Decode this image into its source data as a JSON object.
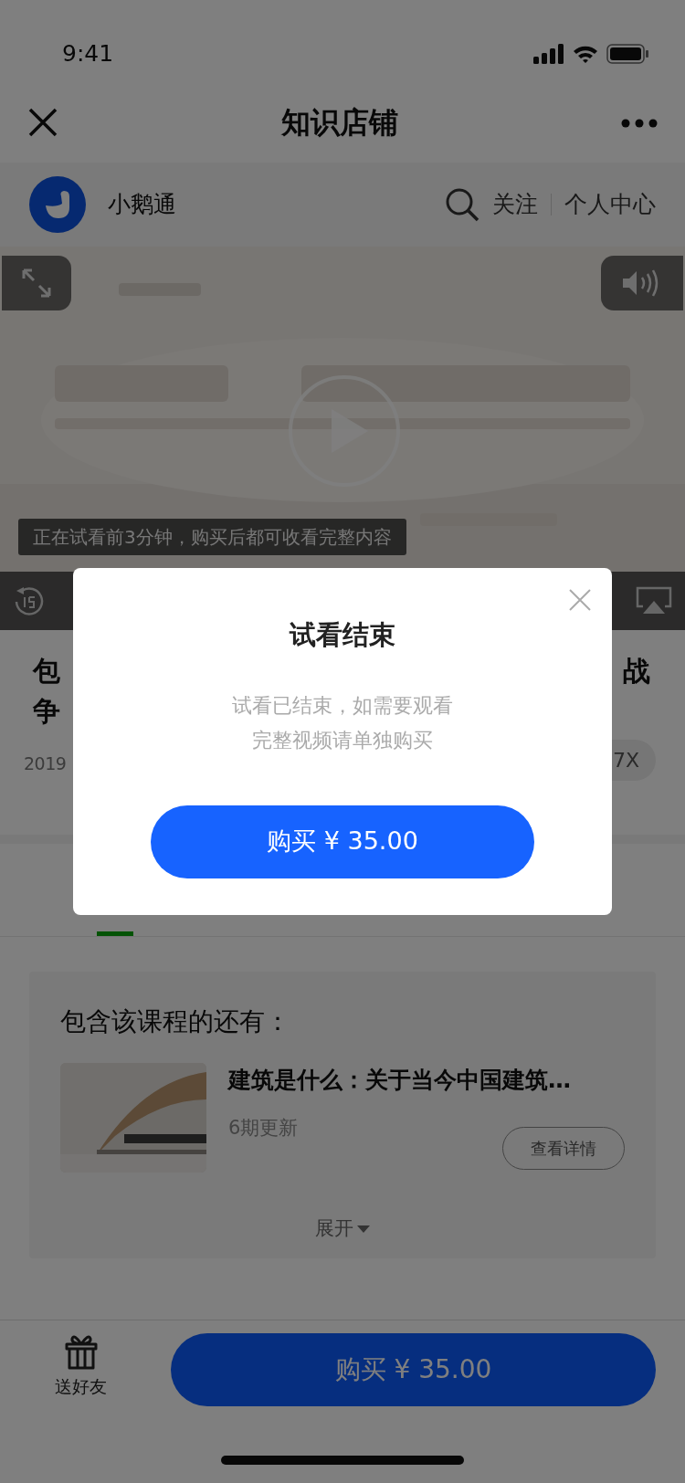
{
  "status_bar": {
    "time": "9:41"
  },
  "nav": {
    "title": "知识店铺"
  },
  "shop": {
    "name": "小鹅通",
    "follow": "关注",
    "personal_center": "个人中心"
  },
  "video": {
    "trial_notice": "正在试看前3分钟，购买后都可收看完整内容"
  },
  "course": {
    "title_line1_start": "包",
    "title_line2_start": "争",
    "title_line1_end": "战",
    "date_start": "2019",
    "speed": "7X"
  },
  "tabs": [
    {
      "selected": true
    }
  ],
  "bundle": {
    "heading": "包含该课程的还有：",
    "items": [
      {
        "title": "建筑是什么：关于当今中国建筑…",
        "updates": "6期更新",
        "action": "查看详情"
      }
    ],
    "expand": "展开"
  },
  "bottom_bar": {
    "gift": "送好友",
    "buy": "购买 ¥ 35.00"
  },
  "dialog": {
    "title": "试看结束",
    "message": "试看已结束，如需要观看完整视频请单独购买",
    "buy": "购买 ¥ 35.00"
  }
}
